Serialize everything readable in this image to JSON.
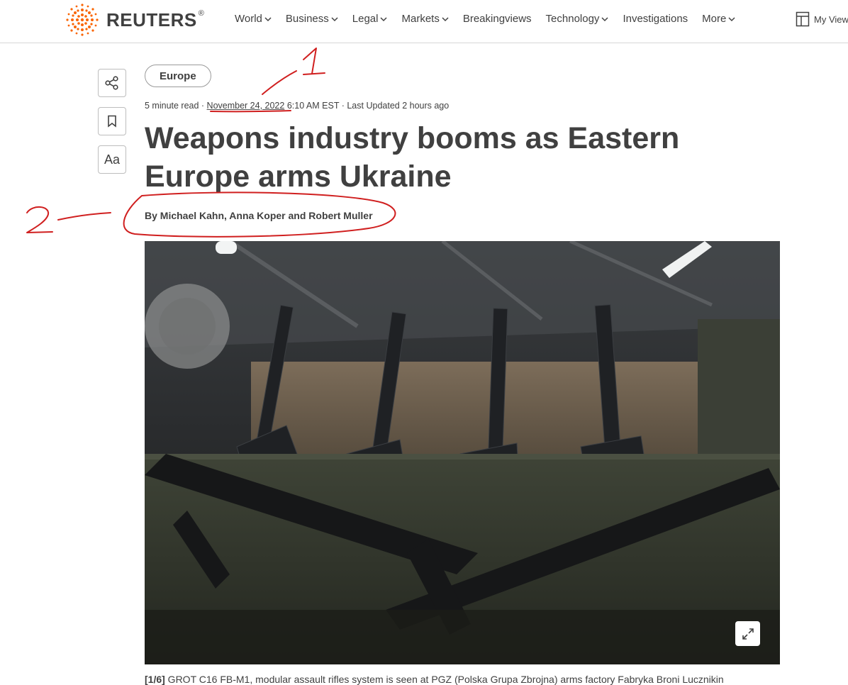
{
  "brand": {
    "name": "REUTERS",
    "reg": "®"
  },
  "nav": [
    {
      "label": "World",
      "has_menu": true
    },
    {
      "label": "Business",
      "has_menu": true
    },
    {
      "label": "Legal",
      "has_menu": true
    },
    {
      "label": "Markets",
      "has_menu": true
    },
    {
      "label": "Breakingviews",
      "has_menu": false
    },
    {
      "label": "Technology",
      "has_menu": true
    },
    {
      "label": "Investigations",
      "has_menu": false
    },
    {
      "label": "More",
      "has_menu": true
    }
  ],
  "my_view": {
    "label": "My View",
    "icon": "layout-icon"
  },
  "rail": {
    "share_icon": "share-icon",
    "bookmark_icon": "bookmark-icon",
    "text_size_label": "Aa"
  },
  "article": {
    "section_tag": "Europe",
    "meta": {
      "read_time": "5 minute read",
      "sep1": " · ",
      "date": "November 24, 2022",
      "time": " 6:10 AM EST",
      "sep2": " · ",
      "updated": "Last Updated 2 hours ago"
    },
    "headline_line1": "Weapons industry booms as Eastern",
    "headline_line2": "Europe arms Ukraine",
    "byline": "By Michael Kahn, Anna Koper and Robert Muller"
  },
  "photo": {
    "alt": "Assault rifles on display at an arms factory",
    "expand_icon": "expand-icon",
    "caption_index": "[1/6]",
    "caption_text": " GROT C16 FB-M1, modular assault rifles system is seen at PGZ (Polska Grupa Zbrojna) arms factory Fabryka Broni Lucznikin"
  },
  "annotations": [
    {
      "label": "1",
      "color": "#d01f1f"
    },
    {
      "label": "2",
      "color": "#d01f1f"
    }
  ],
  "colors": {
    "text": "#404040",
    "logo_orange": "#fa6400",
    "annotation": "#d01f1f"
  }
}
